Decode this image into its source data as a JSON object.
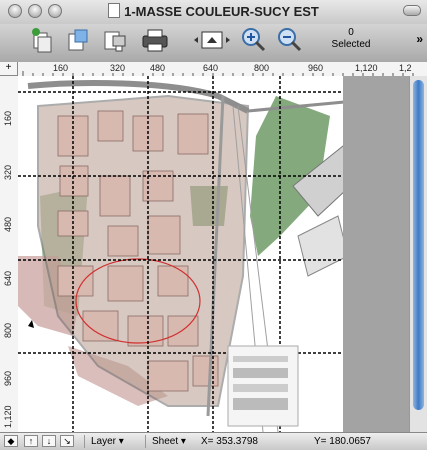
{
  "window": {
    "title": "1-MASSE COULEUR-SUCY EST"
  },
  "toolbar": {
    "selection_count": "0",
    "selection_label": "Selected",
    "buttons": [
      "layers-icon",
      "style-icon",
      "print-setup-icon",
      "printer-icon",
      "page-view-icon",
      "zoom-in-icon",
      "zoom-out-icon"
    ]
  },
  "rulers": {
    "horizontal": [
      "160",
      "320",
      "480",
      "640",
      "800",
      "960",
      "1,120",
      "1,2"
    ],
    "vertical": [
      "160",
      "320",
      "480",
      "640",
      "800",
      "960",
      "1,120"
    ]
  },
  "status": {
    "layer_label": "Layer",
    "sheet_label": "Sheet",
    "x_readout": "X= 353.3798",
    "y_readout": "Y= 180.0657"
  },
  "colors": {
    "window_bg": "#bdbdbd",
    "scroll_thumb": "#3d7ac6",
    "park_green": "#6e9a66",
    "building_pink": "#c9a3a0",
    "road_gray": "#8e8e8e",
    "zone_outline": "#d03030"
  }
}
